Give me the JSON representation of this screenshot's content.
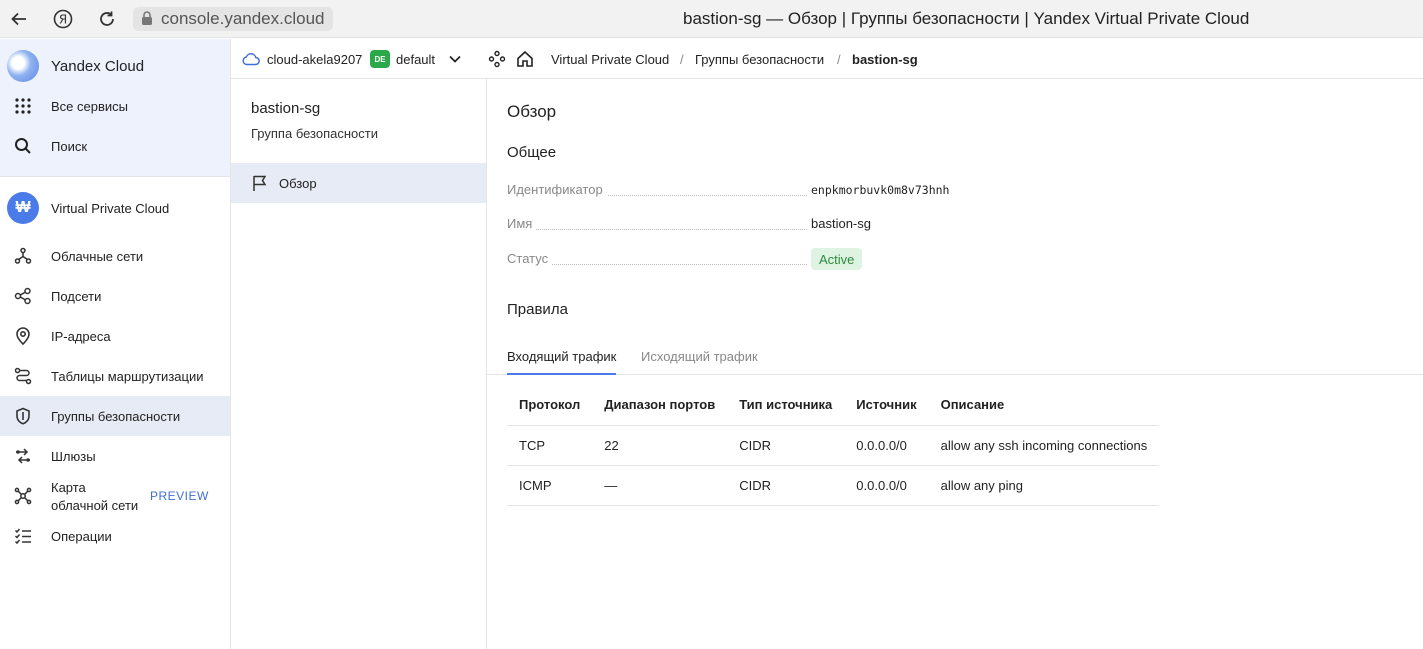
{
  "browser": {
    "url": "console.yandex.cloud",
    "title": "bastion-sg — Обзор | Группы безопасности | Yandex Virtual Private Cloud"
  },
  "sidebar": {
    "brand": "Yandex Cloud",
    "all_services": "Все сервисы",
    "search": "Поиск",
    "service": "Virtual Private Cloud",
    "items": [
      {
        "label": "Облачные сети",
        "icon": "network-icon"
      },
      {
        "label": "Подсети",
        "icon": "subnets-icon"
      },
      {
        "label": "IP-адреса",
        "icon": "location-pin-icon"
      },
      {
        "label": "Таблицы маршрутизации",
        "icon": "route-icon"
      },
      {
        "label": "Группы безопасности",
        "icon": "shield-icon"
      },
      {
        "label": "Шлюзы",
        "icon": "gateway-icon"
      },
      {
        "label": "Карта облачной сети",
        "icon": "map-icon",
        "badge": "PREVIEW"
      },
      {
        "label": "Операции",
        "icon": "list-check-icon"
      }
    ],
    "map_label_line1": "Карта",
    "map_label_line2": "облачной сети"
  },
  "header": {
    "cloud": "cloud-akela9207",
    "folder_badge": "DE",
    "folder": "default",
    "breadcrumbs": [
      "Virtual Private Cloud",
      "Группы безопасности",
      "bastion-sg"
    ],
    "separator": "/"
  },
  "subnav": {
    "title": "bastion-sg",
    "subtitle": "Группа безопасности",
    "item": "Обзор"
  },
  "main": {
    "title": "Обзор",
    "general_heading": "Общее",
    "fields": {
      "id_label": "Идентификатор",
      "id_value": "enpkmorbuvk0m8v73hnh",
      "name_label": "Имя",
      "name_value": "bastion-sg",
      "status_label": "Статус",
      "status_value": "Active"
    },
    "rules_heading": "Правила",
    "tabs": [
      "Входящий трафик",
      "Исходящий трафик"
    ],
    "table": {
      "columns": [
        "Протокол",
        "Диапазон портов",
        "Тип источника",
        "Источник",
        "Описание"
      ],
      "rows": [
        [
          "TCP",
          "22",
          "CIDR",
          "0.0.0.0/0",
          "allow any ssh incoming connections"
        ],
        [
          "ICMP",
          "—",
          "CIDR",
          "0.0.0.0/0",
          "allow any ping"
        ]
      ]
    }
  },
  "colors": {
    "accent": "#4b7be8",
    "active_bg": "#e7ebf6",
    "status_bg": "#dff3e2",
    "status_fg": "#2f8a3c",
    "folder_badge_bg": "#2aa84a"
  }
}
